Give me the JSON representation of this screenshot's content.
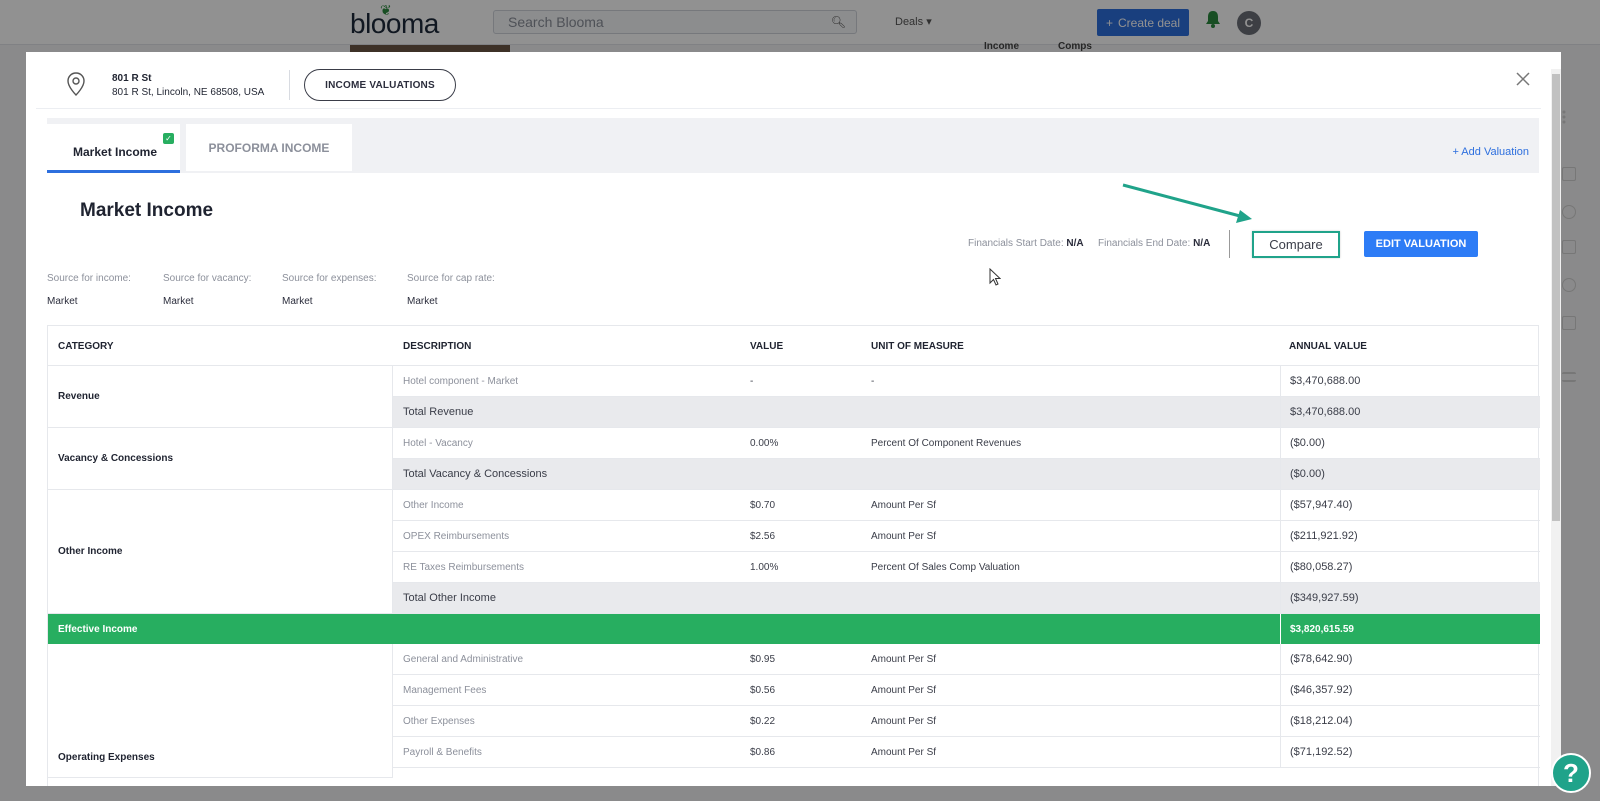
{
  "app": {
    "logo": "blooma",
    "search_placeholder": "Search Blooma",
    "deals_label": "Deals",
    "create_deal_label": "Create deal",
    "avatar_initial": "C",
    "bg_tabs": [
      "Income",
      "Comps"
    ],
    "help_label": "?"
  },
  "modal": {
    "address_title": "801 R St",
    "address_full": "801 R St, Lincoln, NE 68508, USA",
    "income_valuations_button": "INCOME VALUATIONS",
    "tabs": [
      {
        "label": "Market Income",
        "checked": true
      },
      {
        "label": "PROFORMA INCOME",
        "checked": false
      }
    ],
    "add_valuation_label": "+ Add Valuation",
    "title": "Market Income",
    "financials_start_label": "Financials Start Date:",
    "financials_start_value": "N/A",
    "financials_end_label": "Financials End Date:",
    "financials_end_value": "N/A",
    "compare_label": "Compare",
    "edit_label": "EDIT VALUATION",
    "sources": [
      {
        "label": "Source for income:",
        "value": "Market"
      },
      {
        "label": "Source for vacancy:",
        "value": "Market"
      },
      {
        "label": "Source for expenses:",
        "value": "Market"
      },
      {
        "label": "Source for cap rate:",
        "value": "Market"
      }
    ]
  },
  "table": {
    "headers": [
      "CATEGORY",
      "DESCRIPTION",
      "VALUE",
      "UNIT OF MEASURE",
      "ANNUAL VALUE"
    ],
    "groups": [
      {
        "category": "Revenue",
        "rows": [
          {
            "desc": "Hotel component - Market",
            "value": "-",
            "uom": "-",
            "annual": "$3,470,688.00"
          },
          {
            "desc": "Total Revenue",
            "value": "",
            "uom": "",
            "annual": "$3,470,688.00",
            "total": true
          }
        ]
      },
      {
        "category": "Vacancy & Concessions",
        "rows": [
          {
            "desc": "Hotel - Vacancy",
            "value": "0.00%",
            "uom": "Percent Of Component Revenues",
            "annual": "($0.00)"
          },
          {
            "desc": "Total Vacancy & Concessions",
            "value": "",
            "uom": "",
            "annual": "($0.00)",
            "total": true
          }
        ]
      },
      {
        "category": "Other Income",
        "rows": [
          {
            "desc": "Other Income",
            "value": "$0.70",
            "uom": "Amount Per Sf",
            "annual": "($57,947.40)"
          },
          {
            "desc": "OPEX Reimbursements",
            "value": "$2.56",
            "uom": "Amount Per Sf",
            "annual": "($211,921.92)"
          },
          {
            "desc": "RE Taxes Reimbursements",
            "value": "1.00%",
            "uom": "Percent Of Sales Comp Valuation",
            "annual": "($80,058.27)"
          },
          {
            "desc": "Total Other Income",
            "value": "",
            "uom": "",
            "annual": "($349,927.59)",
            "total": true
          }
        ]
      }
    ],
    "effective_income": {
      "label": "Effective Income",
      "annual": "$3,820,615.59"
    },
    "opex": {
      "category": "Operating Expenses",
      "rows": [
        {
          "desc": "General and Administrative",
          "value": "$0.95",
          "uom": "Amount Per Sf",
          "annual": "($78,642.90)"
        },
        {
          "desc": "Management Fees",
          "value": "$0.56",
          "uom": "Amount Per Sf",
          "annual": "($46,357.92)"
        },
        {
          "desc": "Other Expenses",
          "value": "$0.22",
          "uom": "Amount Per Sf",
          "annual": "($18,212.04)"
        },
        {
          "desc": "Payroll & Benefits",
          "value": "$0.86",
          "uom": "Amount Per Sf",
          "annual": "($71,192.52)"
        }
      ]
    }
  },
  "colors": {
    "accent_blue": "#2d7cf6",
    "green": "#27ae60",
    "teal_highlight": "#20a38a"
  }
}
